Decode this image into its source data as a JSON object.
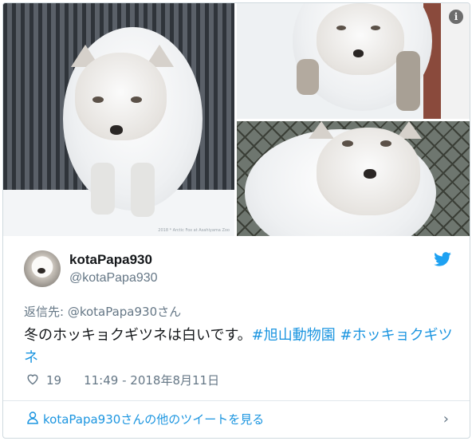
{
  "tweet": {
    "display_name": "kotaPapa930",
    "handle": "@kotaPapa930",
    "reply_to": "返信先: @kotaPapa930さん",
    "text_main": "冬のホッキョクギツネは白いです。",
    "hashtag1": "#旭山動物園",
    "hashtag2": "#ホッキョクギツネ",
    "likes": "19",
    "time": "11:49 - 2018年8月11日",
    "more_tweets_link": "kotaPapa930さんの他のツイートを見る",
    "watermark": "2018 * Arctic Fox at Asahiyama Zoo"
  },
  "icons": {
    "info": "info-icon",
    "twitter": "twitter-bird-icon",
    "heart": "heart-icon",
    "user": "user-icon",
    "chevron": "chevron-right-icon"
  },
  "colors": {
    "link": "#1b95e0",
    "text": "#14171a",
    "muted": "#657786"
  }
}
